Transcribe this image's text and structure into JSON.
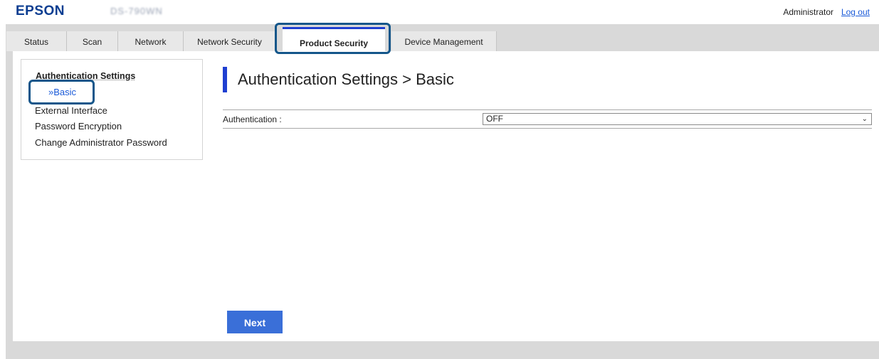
{
  "header": {
    "brand": "EPSON",
    "model": "DS-790WN",
    "user": "Administrator",
    "logout_label": "Log out"
  },
  "tabs": [
    {
      "label": "Status"
    },
    {
      "label": "Scan"
    },
    {
      "label": "Network"
    },
    {
      "label": "Network Security"
    },
    {
      "label": "Product Security",
      "active": true
    },
    {
      "label": "Device Management"
    }
  ],
  "sidebar": {
    "heading": "Authentication Settings",
    "items": [
      {
        "label": "»Basic",
        "active": true
      },
      {
        "label": "External Interface"
      },
      {
        "label": "Password Encryption"
      },
      {
        "label": "Change Administrator Password"
      }
    ]
  },
  "main": {
    "title": "Authentication Settings > Basic",
    "field_label": "Authentication :",
    "field_value": "OFF",
    "next_label": "Next"
  },
  "colors": {
    "brand": "#0b3d91",
    "accent": "#1f3fd1",
    "button": "#3a6fd8",
    "highlight": "#14568a",
    "link": "#1a5ad8"
  }
}
